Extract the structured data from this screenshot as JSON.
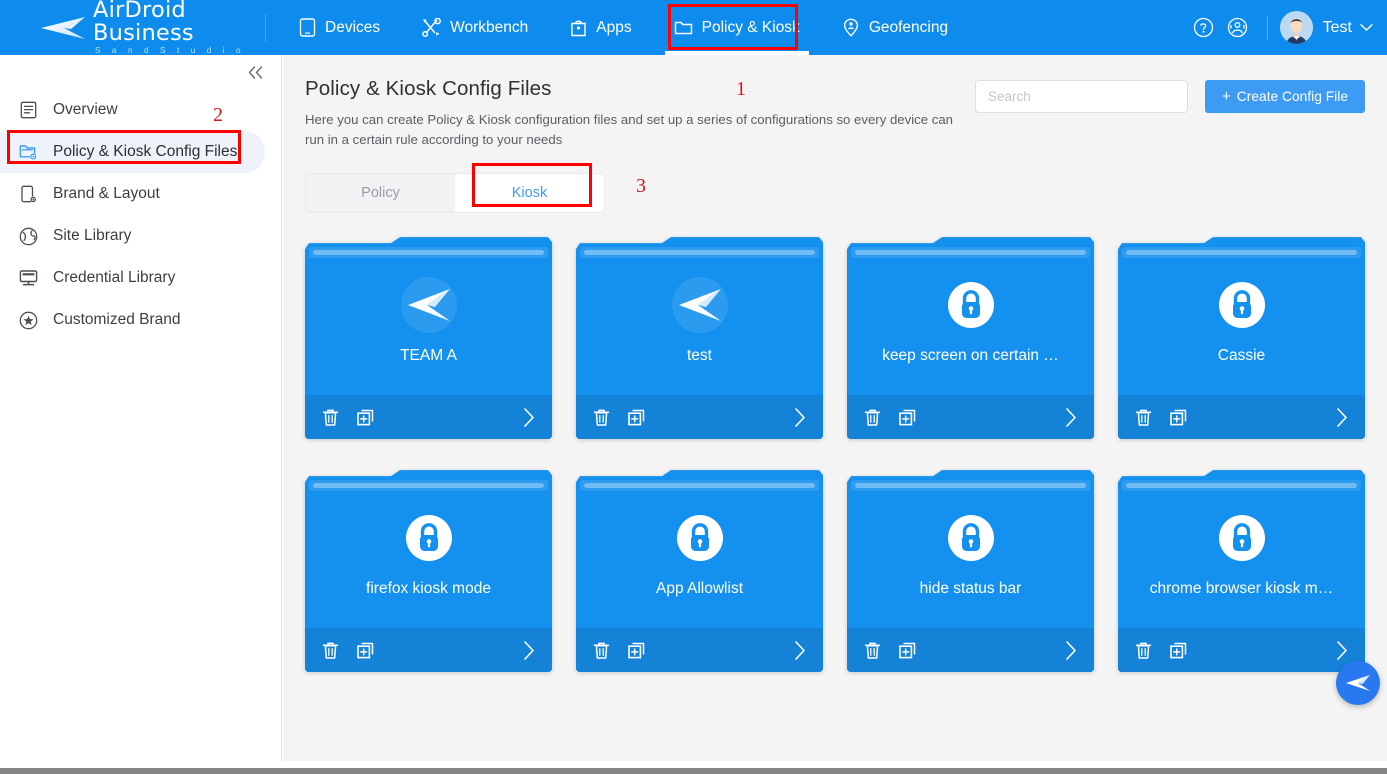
{
  "brand": {
    "name": "AirDroid Business",
    "sub": "S a n d   S t u d i o",
    "logo_icon": "paper-plane-logo"
  },
  "topnav": {
    "items": [
      {
        "label": "Devices",
        "icon": "device-tablet-icon",
        "active": false
      },
      {
        "label": "Workbench",
        "icon": "tools-icon",
        "active": false
      },
      {
        "label": "Apps",
        "icon": "apps-bag-icon",
        "active": false
      },
      {
        "label": "Policy & Kiosk",
        "icon": "folder-icon",
        "active": true
      },
      {
        "label": "Geofencing",
        "icon": "map-pin-person-icon",
        "active": false
      }
    ],
    "help_icon": "question-circle-icon",
    "support_icon": "headset-support-icon",
    "user": {
      "name": "Test",
      "avatar_icon": "user-avatar",
      "caret_icon": "chevron-down-icon"
    }
  },
  "sidebar": {
    "collapse_icon": "double-chevron-left-icon",
    "items": [
      {
        "label": "Overview",
        "icon": "document-list-icon",
        "active": false
      },
      {
        "label": "Policy & Kiosk Config Files",
        "icon": "folder-gear-icon",
        "active": true
      },
      {
        "label": "Brand & Layout",
        "icon": "phone-gear-icon",
        "active": false
      },
      {
        "label": "Site Library",
        "icon": "globe-icon",
        "active": false
      },
      {
        "label": "Credential Library",
        "icon": "monitor-icon",
        "active": false
      },
      {
        "label": "Customized Brand",
        "icon": "star-circle-icon",
        "active": false
      }
    ]
  },
  "page": {
    "title": "Policy & Kiosk Config Files",
    "description": "Here you can create Policy & Kiosk configuration files and set up a series of configurations so every device can run in a certain rule according to your needs"
  },
  "search": {
    "placeholder": "Search",
    "value": ""
  },
  "create_button": {
    "label": "Create Config File",
    "plus": "+",
    "icon": "plus-icon"
  },
  "tabs": [
    {
      "label": "Policy",
      "active": false
    },
    {
      "label": "Kiosk",
      "active": true
    }
  ],
  "cards": [
    {
      "title": "TEAM A",
      "icon": "paper-plane-icon"
    },
    {
      "title": "test",
      "icon": "paper-plane-icon"
    },
    {
      "title": "keep screen on certain …",
      "icon": "lock-icon"
    },
    {
      "title": "Cassie",
      "icon": "lock-icon"
    },
    {
      "title": "firefox kiosk mode",
      "icon": "lock-icon"
    },
    {
      "title": "App Allowlist",
      "icon": "lock-icon"
    },
    {
      "title": "hide status bar",
      "icon": "lock-icon"
    },
    {
      "title": "chrome browser kiosk m…",
      "icon": "lock-icon"
    }
  ],
  "card_actions": {
    "delete_icon": "trash-icon",
    "duplicate_icon": "copy-plus-icon",
    "open_icon": "chevron-right-icon"
  },
  "fab": {
    "icon": "paper-plane-icon"
  },
  "annotations": [
    {
      "number": "1"
    },
    {
      "number": "2"
    },
    {
      "number": "3"
    }
  ],
  "colors": {
    "header_blue": "#0d8ced",
    "accent_blue": "#3d9bf3",
    "card_blue": "#1490ef",
    "card_footer_blue": "#1482d7",
    "page_bg": "#f4f4f4",
    "annotation_red": "#ff0000"
  }
}
